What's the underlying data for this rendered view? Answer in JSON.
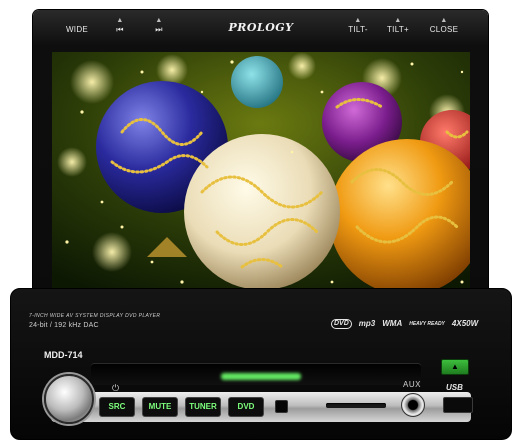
{
  "top_bar": {
    "buttons": [
      {
        "label": "WIDE",
        "indicator": ""
      },
      {
        "label": "",
        "indicator": "▲",
        "icon": "previous-track-icon",
        "glyph": "⏮"
      },
      {
        "label": "",
        "indicator": "▲",
        "icon": "next-track-icon",
        "glyph": "⏭"
      },
      {
        "label": "TILT-",
        "indicator": "▲"
      },
      {
        "label": "TILT+",
        "indicator": "▲"
      },
      {
        "label": "CLOSE",
        "indicator": "▲"
      }
    ],
    "brand": "PROLOGY"
  },
  "screen": {
    "content": "christmas-ornaments-wallpaper"
  },
  "faceplate": {
    "spec_line": "7-INCH WIDE AV SYSTEM DISPLAY DVD PLAYER",
    "dac_line": "24-bit / 192 kHz DAC",
    "model": "MDD-714",
    "aux_label": "AUX",
    "usb_label": "USB",
    "format_logos": [
      {
        "text": "DVD",
        "icon": "dvd-logo"
      },
      {
        "text": "mp3",
        "icon": "mp3-logo"
      },
      {
        "text": "WMA",
        "icon": "wma-logo"
      },
      {
        "text": "HEAVY READY",
        "icon": "heavy-ready-logo"
      },
      {
        "text": "4X50W",
        "icon": "power-rating-logo"
      }
    ],
    "buttons": {
      "src": "SRC",
      "mute": "MUTE",
      "tuner": "TUNER",
      "dvd": "DVD"
    },
    "eject_glyph": "▲",
    "power_glyph": "⏻"
  },
  "colors": {
    "button_text": "#7dff7d",
    "eject": "#2ea82e",
    "body": "#0b0b0b"
  }
}
